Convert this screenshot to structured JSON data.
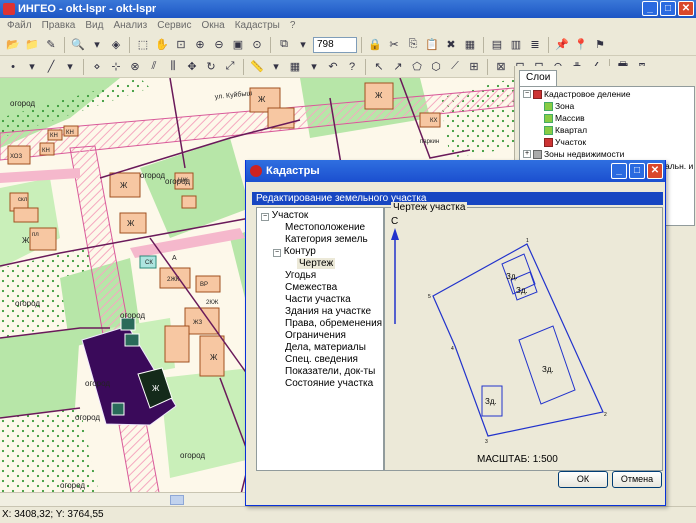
{
  "window": {
    "title": "ИНГЕО - okt-lspr - okt-lspr"
  },
  "menu": [
    "Файл",
    "Правка",
    "Вид",
    "Анализ",
    "Сервис",
    "Окна",
    "Кадастры",
    "?"
  ],
  "toolbar": {
    "zoom_value": "798"
  },
  "map": {
    "street_label": "ул. Куйбыш",
    "labels": {
      "ogorod": "огород",
      "zh": "Ж",
      "kn": "КН",
      "hoz": "ХОЗ",
      "vr": "ВР",
      "zhz": "ЖЗ",
      "pl": "пл",
      "skl": "скл",
      "parkin": "паркин",
      "nzh": "НЖ",
      "kh": "КХ",
      "zhc": "2ЖК",
      "dzh": "2КЖ",
      "a": "А",
      "sk": "СК"
    }
  },
  "status": {
    "coordinates": "X: 3408,32; Y: 3764,55"
  },
  "layers_panel": {
    "tab_label": "Слои",
    "items": [
      {
        "label": "Кадастровое деление",
        "expander": "−",
        "icon": "red"
      },
      {
        "label": "Зона",
        "expander": "",
        "icon": "green"
      },
      {
        "label": "Массив",
        "expander": "",
        "icon": "green"
      },
      {
        "label": "Квартал",
        "expander": "",
        "icon": "green"
      },
      {
        "label": "Участок",
        "expander": "",
        "icon": "red"
      },
      {
        "label": "Зоны недвижимости",
        "expander": "+",
        "icon": "grey"
      },
      {
        "label": "Объекты промышлен., коммунальн. и",
        "expander": "+",
        "icon": "grey"
      }
    ]
  },
  "dialog": {
    "title": "Кадастры",
    "header": "Редактирование земельного участка",
    "tree": [
      "Участок",
      "Местоположение",
      "Категория земель",
      "Контур",
      "Чертеж",
      "Угодья",
      "Смежества",
      "Части участка",
      "Здания на участке",
      "Права, обременения",
      "Ограничения",
      "Дела, материалы",
      "Спец. сведения",
      "Показатели, док-ты",
      "Состояние участка"
    ],
    "tree_expanders": [
      "−",
      "−"
    ],
    "panel_label": "Чертеж участка",
    "north_label": "С",
    "building_labels": [
      "Зд.",
      "Зд.",
      "Зд.",
      "Зд."
    ],
    "vertex_labels": [
      "1",
      "2",
      "3",
      "4",
      "5"
    ],
    "scale_text": "МАСШТАБ: 1:500",
    "ok_label": "ОК",
    "cancel_label": "Отмена"
  }
}
